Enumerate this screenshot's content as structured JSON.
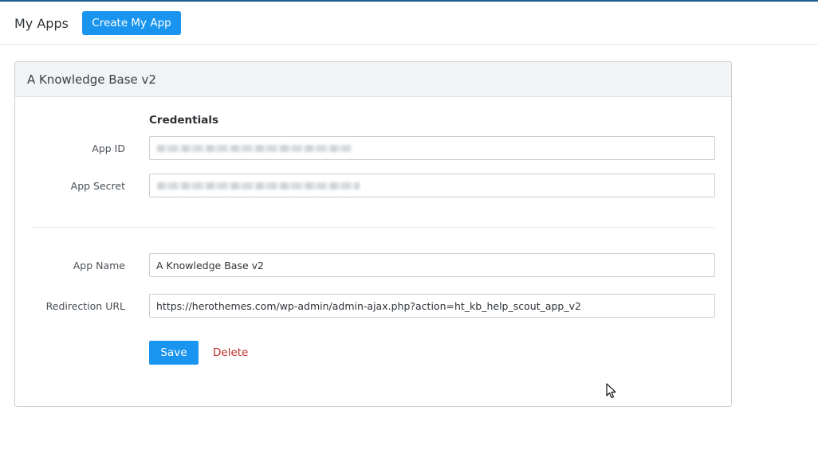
{
  "header": {
    "title": "My Apps",
    "create_button_label": "Create My App"
  },
  "app": {
    "panel_title": "A Knowledge Base v2",
    "credentials": {
      "heading": "Credentials",
      "app_id_label": "App ID",
      "app_id_value": "",
      "app_secret_label": "App Secret",
      "app_secret_value": ""
    },
    "settings": {
      "app_name_label": "App Name",
      "app_name_value": "A Knowledge Base v2",
      "redirect_label": "Redirection URL",
      "redirect_value": "https://herothemes.com/wp-admin/admin-ajax.php?action=ht_kb_help_scout_app_v2"
    },
    "actions": {
      "save_label": "Save",
      "delete_label": "Delete"
    }
  },
  "colors": {
    "primary": "#1a95ef",
    "danger": "#c0302a",
    "top_border": "#1d5e8f",
    "panel_header_bg": "#f1f3f5"
  },
  "icons": {
    "cursor": "mouse-pointer-icon"
  }
}
